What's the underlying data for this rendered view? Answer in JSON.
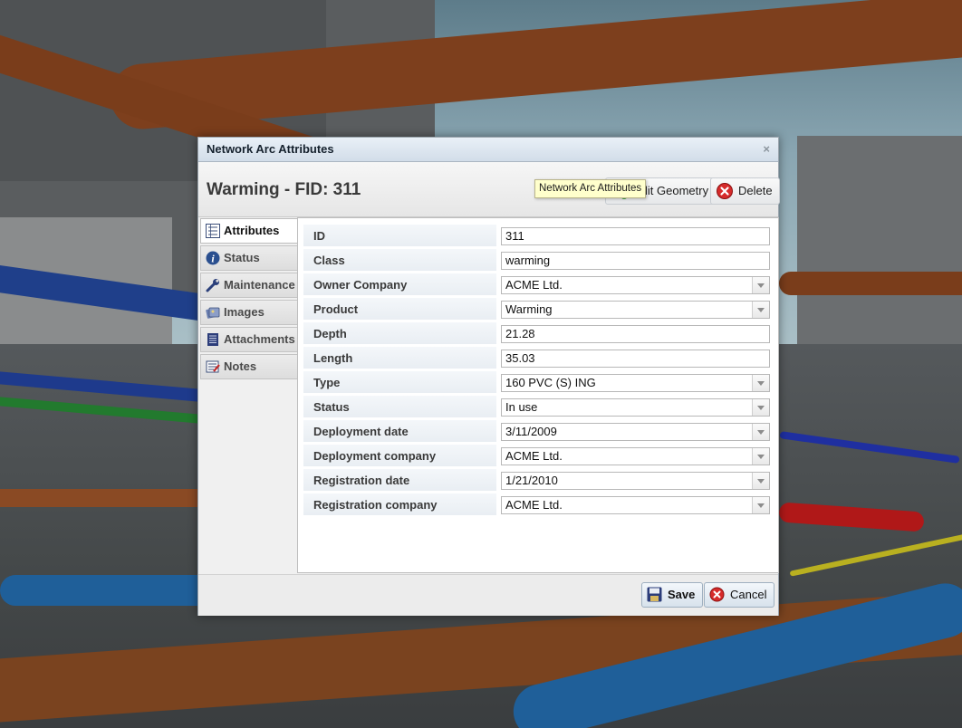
{
  "dialog": {
    "title": "Network Arc Attributes",
    "close_glyph": "×",
    "header_title": "Warming - FID: 311",
    "tooltip": "Network Arc Attributes",
    "toolbar": {
      "edit_geometry_label": "Edit Geometry",
      "edit_geometry_icon": "edit-geometry-icon",
      "delete_label": "Delete",
      "delete_icon": "delete-icon"
    },
    "tabs": [
      {
        "label": "Attributes",
        "icon": "list-icon",
        "active": true
      },
      {
        "label": "Status",
        "icon": "info-icon",
        "active": false
      },
      {
        "label": "Maintenance",
        "icon": "wrench-icon",
        "active": false
      },
      {
        "label": "Images",
        "icon": "images-icon",
        "active": false
      },
      {
        "label": "Attachments",
        "icon": "attachment-icon",
        "active": false
      },
      {
        "label": "Notes",
        "icon": "notes-icon",
        "active": false
      }
    ],
    "fields": [
      {
        "label": "ID",
        "value": "311",
        "type": "text"
      },
      {
        "label": "Class",
        "value": "warming",
        "type": "text"
      },
      {
        "label": "Owner Company",
        "value": "ACME Ltd.",
        "type": "combo"
      },
      {
        "label": "Product",
        "value": "Warming",
        "type": "combo"
      },
      {
        "label": "Depth",
        "value": "21.28",
        "type": "text"
      },
      {
        "label": "Length",
        "value": "35.03",
        "type": "text"
      },
      {
        "label": "Type",
        "value": "160 PVC (S) ING",
        "type": "combo"
      },
      {
        "label": "Status",
        "value": "In use",
        "type": "combo"
      },
      {
        "label": "Deployment date",
        "value": "3/11/2009",
        "type": "combo"
      },
      {
        "label": "Deployment company",
        "value": "ACME Ltd.",
        "type": "combo"
      },
      {
        "label": "Registration date",
        "value": "1/21/2010",
        "type": "combo"
      },
      {
        "label": "Registration company",
        "value": "ACME Ltd.",
        "type": "combo"
      }
    ],
    "footer": {
      "save_label": "Save",
      "cancel_label": "Cancel"
    }
  },
  "colors": {
    "title_bar": "#d2dde9",
    "label_bg": "#eaeff4",
    "tooltip_bg": "#ffffcc",
    "pipe_orange": "#8a4a24",
    "pipe_blue": "#1f5f99"
  }
}
